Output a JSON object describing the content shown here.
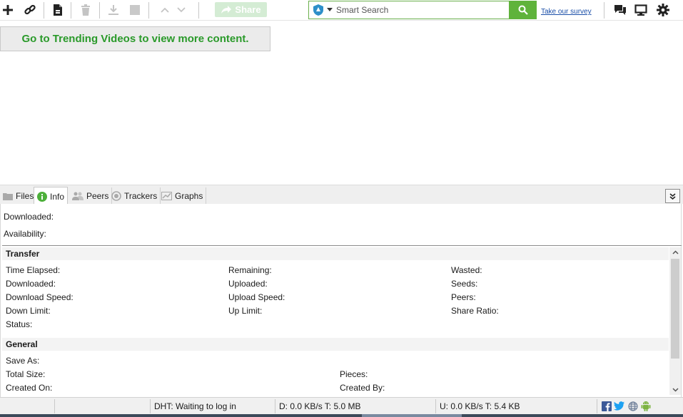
{
  "toolbar": {
    "share_label": "Share",
    "icons": [
      "add-torrent-icon",
      "add-url-icon",
      "create-torrent-icon",
      "delete-icon",
      "download-icon",
      "stop-icon",
      "move-up-icon",
      "move-down-icon",
      "chat-icon",
      "remote-icon",
      "settings-icon"
    ]
  },
  "search": {
    "placeholder": "Smart Search",
    "value": ""
  },
  "survey_link": "Take our survey",
  "banner": "Go to Trending Videos to view more content.",
  "tabs": [
    {
      "label": "Files",
      "icon": "folder-icon",
      "active": false
    },
    {
      "label": "Info",
      "icon": "info-icon",
      "active": true
    },
    {
      "label": "Peers",
      "icon": "peers-icon",
      "active": false
    },
    {
      "label": "Trackers",
      "icon": "trackers-icon",
      "active": false
    },
    {
      "label": "Graphs",
      "icon": "graph-icon",
      "active": false
    }
  ],
  "info": {
    "downloaded_label": "Downloaded:",
    "availability_label": "Availability:",
    "transfer": {
      "title": "Transfer",
      "col1": [
        "Time Elapsed:",
        "Downloaded:",
        "Download Speed:",
        "Down Limit:",
        "Status:"
      ],
      "col2": [
        "Remaining:",
        "Uploaded:",
        "Upload Speed:",
        "Up Limit:"
      ],
      "col3": [
        "Wasted:",
        "Seeds:",
        "Peers:",
        "Share Ratio:"
      ]
    },
    "general": {
      "title": "General",
      "col1": [
        "Save As:",
        "Total Size:",
        "Created On:"
      ],
      "col2": [
        "Pieces:",
        "Created By:"
      ]
    }
  },
  "status": {
    "dht": "DHT: Waiting to log in",
    "download": "D: 0.0 KB/s T: 5.0 MB",
    "upload": "U: 0.0 KB/s T: 5.4 KB"
  },
  "colors": {
    "accent_green": "#5fb33b",
    "banner_text": "#2a9a2a",
    "link_blue": "#1b4fa8"
  }
}
